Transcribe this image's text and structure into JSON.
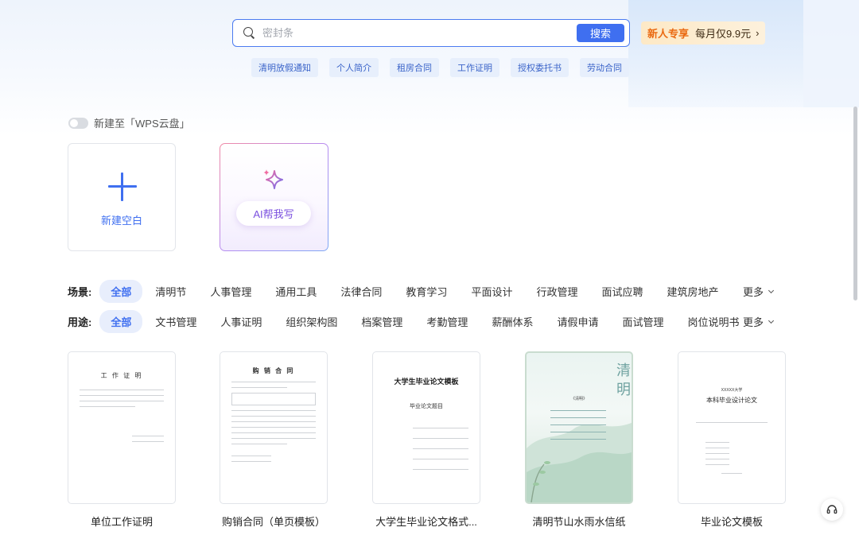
{
  "search": {
    "placeholder": "密封条",
    "button_label": "搜索"
  },
  "promo": {
    "badge": "新人专享",
    "text": "每月仅9.9元",
    "arrow": "›"
  },
  "hot_tags": [
    "清明放假通知",
    "个人简介",
    "租房合同",
    "工作证明",
    "授权委托书",
    "劳动合同"
  ],
  "toggle": {
    "label": "新建至「WPS云盘」",
    "on": false
  },
  "create": {
    "blank_label": "新建空白",
    "ai_label": "AI帮我写"
  },
  "scene": {
    "label": "场景:",
    "items": [
      "全部",
      "清明节",
      "人事管理",
      "通用工具",
      "法律合同",
      "教育学习",
      "平面设计",
      "行政管理",
      "面试应聘",
      "建筑房地产"
    ],
    "more": "更多"
  },
  "usage": {
    "label": "用途:",
    "items": [
      "全部",
      "文书管理",
      "人事证明",
      "组织架构图",
      "档案管理",
      "考勤管理",
      "薪酬体系",
      "请假申请",
      "面试管理",
      "岗位说明书"
    ],
    "more": "更多"
  },
  "templates": [
    {
      "name": "单位工作证明",
      "thumb_title": "工 作 证 明"
    },
    {
      "name": "购销合同（单页模板）",
      "thumb_title": "购 销 合 同"
    },
    {
      "name": "大学生毕业论文格式...",
      "thumb_title": "大学生毕业论文模板",
      "thumb_subtitle": "毕业论文题目"
    },
    {
      "name": "清明节山水雨水信纸",
      "thumb_title": "清明",
      "thumb_subtitle": "《清明》"
    },
    {
      "name": "毕业论文模板",
      "thumb_title": "本科毕业设计论文",
      "thumb_subtitle": "XXXXX大学"
    }
  ],
  "colors": {
    "accent": "#3f6ff0",
    "promo_orange": "#ea6a12"
  }
}
